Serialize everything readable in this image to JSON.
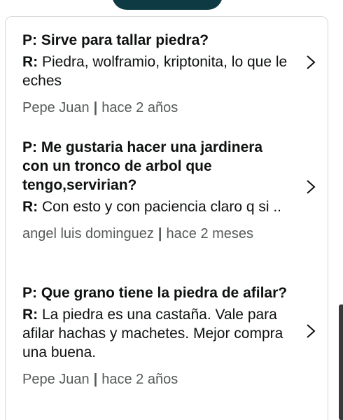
{
  "items": [
    {
      "question": "P: Sirve para tallar piedra?",
      "answer_prefix": "R:",
      "answer_text": " Piedra, wolframio, kriptonita, lo que le eches",
      "author": "Pepe Juan",
      "separator": "|",
      "time": "hace 2 años"
    },
    {
      "question": "P: Me gustaria hacer una jardinera con un tronco de arbol que tengo,servirian?",
      "answer_prefix": "R:",
      "answer_text": " Con esto y con paciencia claro q si ..",
      "author": "angel luis dominguez",
      "separator": "|",
      "time": "hace 2 meses"
    },
    {
      "question": "P: Que grano tiene la piedra de afilar?",
      "answer_prefix": "R:",
      "answer_text": " La piedra es una castaña. Vale para afilar hachas y machetes. Mejor compra una buena.",
      "author": "Pepe Juan",
      "separator": "|",
      "time": "hace 2 años"
    }
  ],
  "icons": {
    "chevron": "chevron-right-icon"
  },
  "colors": {
    "top_button": "#0e3b43",
    "meta_text": "#565959",
    "card_border": "#d5d9d9"
  }
}
